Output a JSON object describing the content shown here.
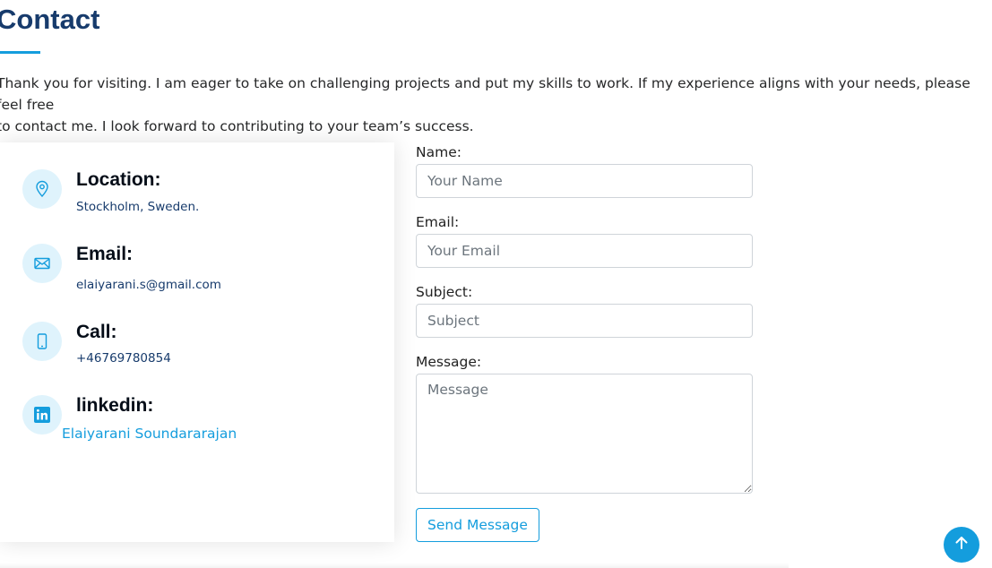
{
  "section": {
    "title": "Contact",
    "intro": "Thank you for visiting. I am eager to take on challenging projects and put my skills to work. If my experience aligns with your needs, please feel free\nto contact me. I look forward to contributing to your team’s success."
  },
  "info": {
    "location": {
      "icon": "location-pin-icon",
      "heading": "Location:",
      "text": "Stockholm, Sweden."
    },
    "email": {
      "icon": "envelope-icon",
      "heading": "Email:",
      "text": "elaiyarani.s@gmail.com"
    },
    "call": {
      "icon": "phone-icon",
      "heading": "Call:",
      "text": "+46769780854"
    },
    "linkedin": {
      "icon": "linkedin-icon",
      "heading": "linkedin:",
      "link_text": "Elaiyarani Soundararajan"
    }
  },
  "form": {
    "name_label": "Name:",
    "name_placeholder": "Your Name",
    "email_label": "Email:",
    "email_placeholder": "Your Email",
    "subject_label": "Subject:",
    "subject_placeholder": "Subject",
    "message_label": "Message:",
    "message_placeholder": "Message",
    "submit_label": "Send Message"
  },
  "back_to_top": {
    "icon": "arrow-up-icon"
  },
  "colors": {
    "accent": "#149ddd",
    "title": "#173b6c",
    "icon_bg": "#dff3fc"
  }
}
